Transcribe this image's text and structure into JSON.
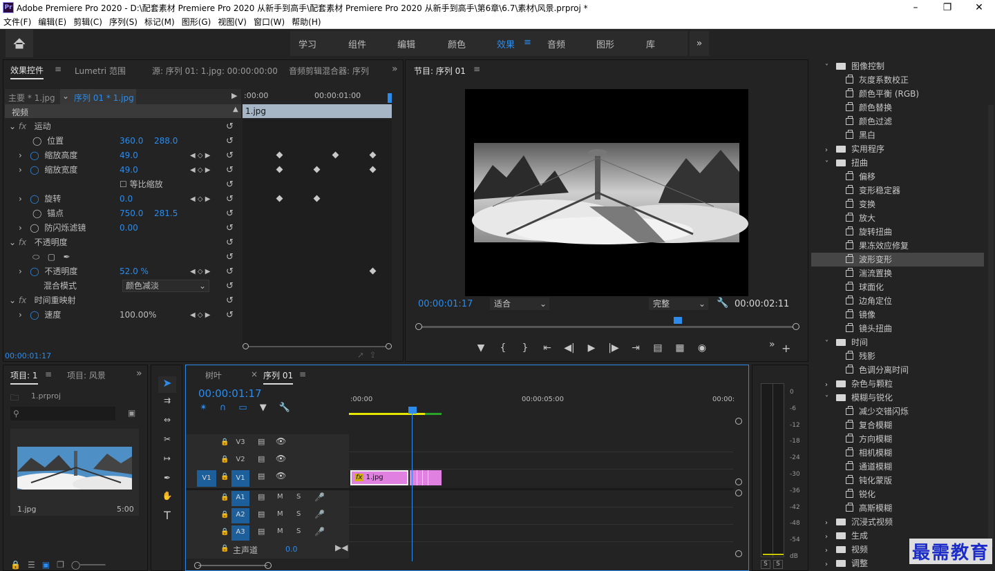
{
  "titlebar": {
    "app_badge": "Pr",
    "title": "Adobe Premiere Pro 2020 - D:\\配套素材 Premiere Pro 2020 从新手到高手\\配套素材 Premiere Pro 2020 从新手到高手\\第6章\\6.7\\素材\\风景.prproj *"
  },
  "menu": [
    "文件(F)",
    "编辑(E)",
    "剪辑(C)",
    "序列(S)",
    "标记(M)",
    "图形(G)",
    "视图(V)",
    "窗口(W)",
    "帮助(H)"
  ],
  "workspaces": [
    "学习",
    "组件",
    "编辑",
    "颜色",
    "效果",
    "音频",
    "图形",
    "库"
  ],
  "active_workspace": "效果",
  "effect_controls": {
    "tabs": [
      "效果控件",
      "Lumetri 范围",
      "源: 序列 01: 1.jpg: 00:00:00:00",
      "音频剪辑混合器: 序列"
    ],
    "master": "主要 * 1.jpg",
    "sequence": "序列 01 * 1.jpg",
    "tc_start": ":00:00",
    "tc_mid": "00:00:01:00",
    "clip_name": "1.jpg",
    "video_header": "视频",
    "rows": [
      {
        "label": "fx 运动",
        "indent": 1
      },
      {
        "label": "位置",
        "v1": "360.0",
        "v2": "288.0"
      },
      {
        "label": "缩放高度",
        "v1": "49.0"
      },
      {
        "label": "缩放宽度",
        "v1": "49.0"
      },
      {
        "label": "等比缩放"
      },
      {
        "label": "旋转",
        "v1": "0.0"
      },
      {
        "label": "锚点",
        "v1": "750.0",
        "v2": "281.5"
      },
      {
        "label": "防闪烁滤镜",
        "v1": "0.00"
      },
      {
        "label": "fx 不透明度"
      },
      {
        "label": "不透明度",
        "v1": "52.0 %"
      },
      {
        "label": "混合模式",
        "v1": "颜色减淡"
      },
      {
        "label": "fx 时间重映射"
      },
      {
        "label": "速度",
        "v1": "100.00%"
      }
    ],
    "motion": "运动",
    "position": "位置",
    "pos_x": "360.0",
    "pos_y": "288.0",
    "scale_h": "缩放高度",
    "scale_h_v": "49.0",
    "scale_w": "缩放宽度",
    "scale_w_v": "49.0",
    "uniform": "等比缩放",
    "rotation": "旋转",
    "rotation_v": "0.0",
    "anchor": "锚点",
    "anchor_x": "750.0",
    "anchor_y": "281.5",
    "flicker": "防闪烁滤镜",
    "flicker_v": "0.00",
    "opacity_group": "不透明度",
    "opacity": "不透明度",
    "opacity_v": "52.0 %",
    "blend": "混合模式",
    "blend_v": "颜色减淡",
    "time_remap": "时间重映射",
    "speed": "速度",
    "speed_v": "100.00%",
    "timecode": "00:00:01:17"
  },
  "program": {
    "tab": "节目: 序列 01",
    "timecode": "00:00:01:17",
    "fit": "适合",
    "quality": "完整",
    "duration": "00:00:02:11"
  },
  "effects_tree": [
    {
      "label": "图像控制",
      "type": "folder",
      "open": true
    },
    {
      "label": "灰度系数校正",
      "type": "fx"
    },
    {
      "label": "颜色平衡 (RGB)",
      "type": "fx"
    },
    {
      "label": "颜色替换",
      "type": "fx"
    },
    {
      "label": "颜色过滤",
      "type": "fx"
    },
    {
      "label": "黑白",
      "type": "fx"
    },
    {
      "label": "实用程序",
      "type": "folder",
      "open": false
    },
    {
      "label": "扭曲",
      "type": "folder",
      "open": true
    },
    {
      "label": "偏移",
      "type": "fx"
    },
    {
      "label": "变形稳定器",
      "type": "fx"
    },
    {
      "label": "变换",
      "type": "fx"
    },
    {
      "label": "放大",
      "type": "fx"
    },
    {
      "label": "旋转扭曲",
      "type": "fx"
    },
    {
      "label": "果冻效应修复",
      "type": "fx"
    },
    {
      "label": "波形变形",
      "type": "fx",
      "selected": true
    },
    {
      "label": "湍流置换",
      "type": "fx"
    },
    {
      "label": "球面化",
      "type": "fx"
    },
    {
      "label": "边角定位",
      "type": "fx"
    },
    {
      "label": "镜像",
      "type": "fx"
    },
    {
      "label": "镜头扭曲",
      "type": "fx"
    },
    {
      "label": "时间",
      "type": "folder",
      "open": true
    },
    {
      "label": "残影",
      "type": "fx"
    },
    {
      "label": "色调分离时间",
      "type": "fx"
    },
    {
      "label": "杂色与颗粒",
      "type": "folder",
      "open": false
    },
    {
      "label": "模糊与锐化",
      "type": "folder",
      "open": true
    },
    {
      "label": "减少交错闪烁",
      "type": "fx"
    },
    {
      "label": "复合模糊",
      "type": "fx"
    },
    {
      "label": "方向模糊",
      "type": "fx"
    },
    {
      "label": "相机模糊",
      "type": "fx"
    },
    {
      "label": "通道模糊",
      "type": "fx"
    },
    {
      "label": "钝化蒙版",
      "type": "fx"
    },
    {
      "label": "锐化",
      "type": "fx"
    },
    {
      "label": "高斯模糊",
      "type": "fx"
    },
    {
      "label": "沉浸式视频",
      "type": "folder",
      "open": false
    },
    {
      "label": "生成",
      "type": "folder",
      "open": false
    },
    {
      "label": "视频",
      "type": "folder",
      "open": false
    },
    {
      "label": "调整",
      "type": "folder",
      "open": false
    }
  ],
  "project": {
    "tabs": [
      "项目: 1",
      "项目: 风景"
    ],
    "file": "1.prproj",
    "item_name": "1.jpg",
    "item_duration": "5:00"
  },
  "timeline": {
    "tabs": [
      "树叶",
      "序列 01"
    ],
    "timecode": "00:00:01:17",
    "ruler": [
      ":00:00",
      "00:00:05:00",
      "00:00:"
    ],
    "tracks_video": [
      "V3",
      "V2",
      "V1"
    ],
    "tracks_audio": [
      "A1",
      "A2",
      "A3"
    ],
    "source_patch": "V1",
    "master": "主声道",
    "master_val": "0.0",
    "clip": "1.jpg",
    "m": "M",
    "s": "S"
  },
  "meter": {
    "ticks": [
      "0",
      "-6",
      "-12",
      "-18",
      "-24",
      "-30",
      "-36",
      "-42",
      "-48",
      "-54",
      "dB"
    ],
    "solo": [
      "S",
      "S"
    ]
  },
  "watermark": "最需教育"
}
